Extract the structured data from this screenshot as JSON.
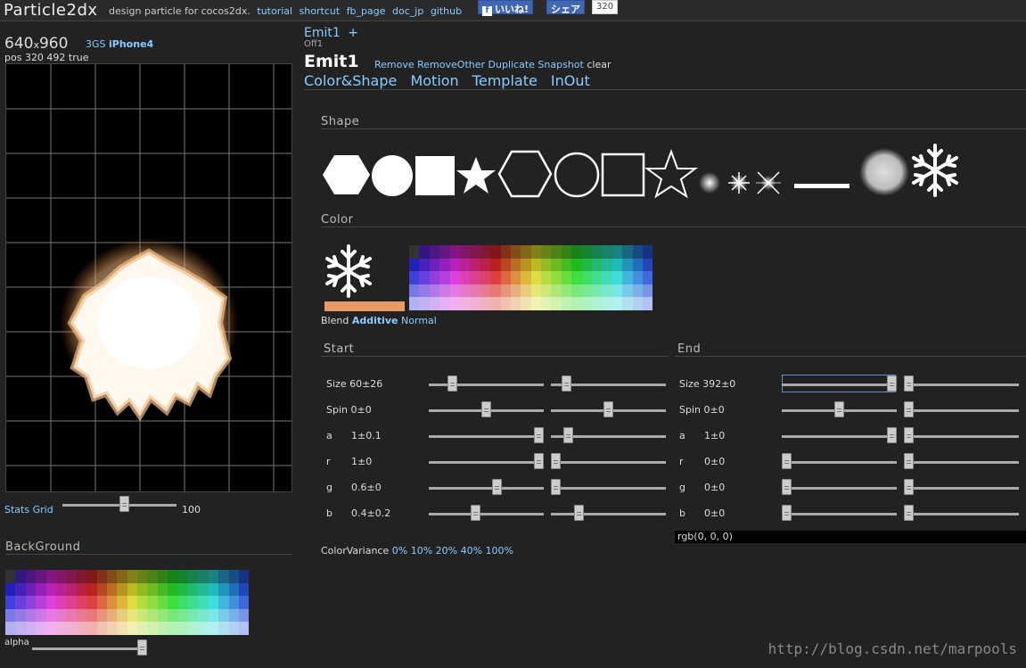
{
  "header": {
    "brand": "Particle2dx",
    "tagline": "design particle for cocos2dx.",
    "links": [
      "tutorial",
      "shortcut",
      "fb_page",
      "doc_jp",
      "github"
    ],
    "fb_like": "いいね!",
    "fb_share": "シェア",
    "fb_count": "320"
  },
  "device": {
    "width": "640",
    "x": "x",
    "height": "960",
    "presets": [
      "3GS",
      "iPhone4"
    ],
    "pos_text": "pos 320 492 true"
  },
  "stats": {
    "stats_label": "Stats",
    "grid_label": "Grid",
    "grid_value": "100",
    "grid_level": 0.55
  },
  "background": {
    "title": "BackGround",
    "alpha_label": "alpha",
    "alpha_level": 1.0
  },
  "emitter": {
    "tab": "Emit1",
    "add": "+",
    "state": "Off1",
    "title": "Emit1",
    "actions": [
      "Remove",
      "RemoveOther",
      "Duplicate",
      "Snapshot"
    ],
    "clear": "clear",
    "tabs": [
      "Color&Shape",
      "Motion",
      "Template",
      "InOut"
    ]
  },
  "shape": {
    "title": "Shape",
    "icons": [
      "hexagon-icon",
      "circle-icon",
      "square-icon",
      "star-icon",
      "hexagon-outline-icon",
      "circle-outline-icon",
      "square-outline-icon",
      "star-outline-icon",
      "soft-dot-icon",
      "sparkle-icon",
      "flare-icon",
      "line-icon",
      "smoke-icon",
      "snowflake-icon"
    ]
  },
  "color": {
    "title": "Color",
    "preview_icon": "snowflake-icon",
    "preview_swatch": "#e89a66",
    "blend_label": "Blend",
    "blend_modes": [
      "Additive",
      "Normal"
    ],
    "blend_active": "Additive",
    "variance_label": "ColorVariance",
    "variance_options": [
      "0%",
      "10%",
      "20%",
      "40%",
      "100%"
    ]
  },
  "start": {
    "title": "Start",
    "rows": [
      {
        "label": "Size 60±26",
        "value": 0.18,
        "variance": 0.1
      },
      {
        "label": "Spin 0±0",
        "value": 0.5,
        "variance": 0.5
      },
      {
        "label": "a",
        "valtext": "1±0.1",
        "value": 1.0,
        "variance": 0.12
      },
      {
        "label": "r",
        "valtext": "1±0",
        "value": 1.0,
        "variance": 0.0
      },
      {
        "label": "g",
        "valtext": "0.6±0",
        "value": 0.6,
        "variance": 0.0
      },
      {
        "label": "b",
        "valtext": "0.4±0.2",
        "value": 0.4,
        "variance": 0.22
      }
    ]
  },
  "end": {
    "title": "End",
    "rows": [
      {
        "label": "Size 392±0",
        "value": 1.0,
        "variance": 0.0
      },
      {
        "label": "Spin 0±0",
        "value": 0.5,
        "variance": 0.0
      },
      {
        "label": "a",
        "valtext": "1±0",
        "value": 1.0,
        "variance": 0.0
      },
      {
        "label": "r",
        "valtext": "0±0",
        "value": 0.0,
        "variance": 0.0
      },
      {
        "label": "g",
        "valtext": "0±0",
        "value": 0.0,
        "variance": 0.0
      },
      {
        "label": "b",
        "valtext": "0±0",
        "value": 0.0,
        "variance": 0.0
      }
    ],
    "rgb_text": "rgb(0, 0, 0)"
  },
  "watermark": "http://blog.csdn.net/marpools"
}
